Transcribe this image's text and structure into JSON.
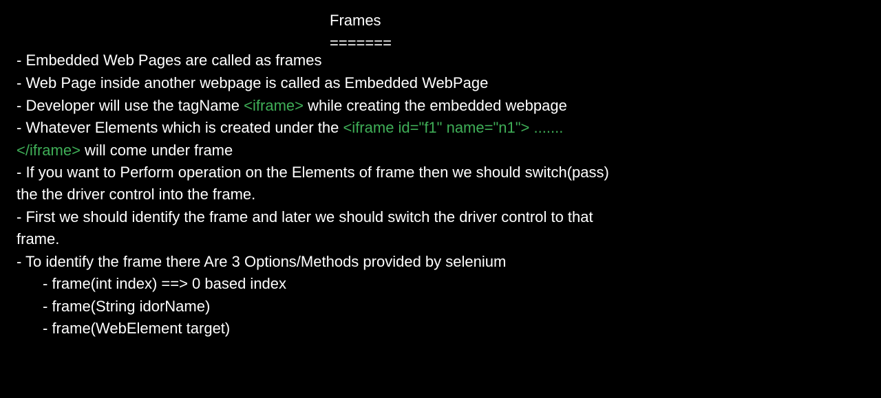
{
  "title": "Frames",
  "title_underline": "=======",
  "lines": {
    "l1": "- Embedded Web Pages are called as frames",
    "l2": "- Web Page inside another webpage is called as Embedded WebPage",
    "l3a": "- Developer will use the tagName ",
    "l3b": "<iframe>",
    "l3c": " while creating the embedded webpage",
    "l4a": "- Whatever Elements which is created under the ",
    "l4b": "<iframe id=\"f1\" name=\"n1\"> .......",
    "l5a": "</iframe>",
    "l5b": " will come under frame",
    "l6": "- If you want to Perform operation on the Elements of frame then we should switch(pass)",
    "l7": "the the driver control into the frame.",
    "l8": "- First we should identify the frame and later we should switch the driver control to that",
    "l9": "frame.",
    "l10": "- To identify the frame there Are 3 Options/Methods provided by selenium",
    "m1": "- frame(int index) ==> 0 based index",
    "m2": "- frame(String idorName)",
    "m3": "- frame(WebElement target)"
  },
  "colors": {
    "background": "#000000",
    "text": "#ffffff",
    "code": "#3fae57"
  }
}
